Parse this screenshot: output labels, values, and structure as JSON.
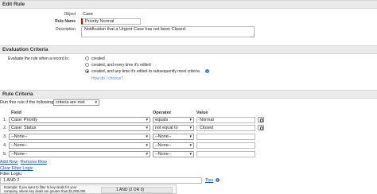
{
  "edit_rule": {
    "title": "Edit Rule",
    "object_label": "Object",
    "object_value": "Case",
    "rule_name_label": "Rule Name",
    "rule_name_value": "Priority Normal",
    "description_label": "Description",
    "description_value": "Notification that a Urgent Case has not been Closed."
  },
  "evaluation": {
    "title": "Evaluation Criteria",
    "prompt": "Evaluate the rule when a record is:",
    "options": [
      "created",
      "created, and every time it's edited",
      "created, and any time it's edited to subsequently meet criteria"
    ],
    "selected_index": 2,
    "help_link": "How do I choose?"
  },
  "criteria": {
    "title": "Rule Criteria",
    "run_label": "Run this rule if the following",
    "run_select": "criteria are met",
    "col_field": "Field",
    "col_operator": "Operator",
    "col_value": "Value",
    "rows": [
      {
        "num": "1.",
        "field": "Case: Priority",
        "operator": "equals",
        "value": "Normal"
      },
      {
        "num": "2.",
        "field": "Case: Status",
        "operator": "not equal to",
        "value": "Closed"
      },
      {
        "num": "3.",
        "field": "--None--",
        "operator": "--None--",
        "value": ""
      },
      {
        "num": "4.",
        "field": "--None--",
        "operator": "--None--",
        "value": ""
      },
      {
        "num": "5.",
        "field": "--None--",
        "operator": "--None--",
        "value": ""
      }
    ],
    "add_row": "Add Row",
    "remove_row": "Remove Row",
    "clear_filter_logic": "Clear Filter Logic",
    "filter_logic_label": "Filter Logic:",
    "filter_logic_value": "1 AND 2",
    "tips": "Tips",
    "example_text": "Example: If you want to filter to key deals for your company, where key deals are greater than $1,000,000",
    "example_box_text": "1 AND (2 OR 3)"
  }
}
